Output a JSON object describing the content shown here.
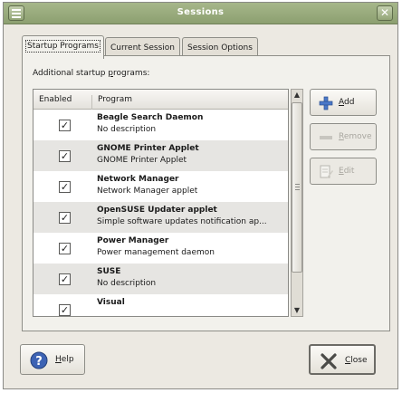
{
  "window": {
    "title": "Sessions"
  },
  "tabs": [
    {
      "label": "Startup Programs",
      "active": true
    },
    {
      "label": "Current Session",
      "active": false
    },
    {
      "label": "Session Options",
      "active": false
    }
  ],
  "startup": {
    "heading": "Additional startup programs:",
    "columns": {
      "enabled": "Enabled",
      "program": "Program"
    },
    "rows": [
      {
        "name": "Beagle Search Daemon",
        "description": "No description",
        "enabled": true
      },
      {
        "name": "GNOME Printer Applet",
        "description": "GNOME Printer Applet",
        "enabled": true
      },
      {
        "name": "Network Manager",
        "description": "Network Manager applet",
        "enabled": true
      },
      {
        "name": "OpenSUSE Updater applet",
        "description": "Simple software updates notification ap...",
        "enabled": true
      },
      {
        "name": "Power Manager",
        "description": "Power management daemon",
        "enabled": true
      },
      {
        "name": "SUSE",
        "description": "No description",
        "enabled": true
      },
      {
        "name": "Visual",
        "description": "",
        "enabled": true
      }
    ]
  },
  "buttons": {
    "add": {
      "pre": "",
      "accel": "A",
      "post": "dd",
      "enabled": true,
      "icon": "plus-icon"
    },
    "remove": {
      "pre": "",
      "accel": "R",
      "post": "emove",
      "enabled": false,
      "icon": "minus-icon"
    },
    "edit": {
      "pre": "",
      "accel": "E",
      "post": "dit",
      "enabled": false,
      "icon": "edit-icon"
    },
    "help": {
      "pre": "",
      "accel": "H",
      "post": "elp",
      "icon": "help-icon"
    },
    "close": {
      "pre": "",
      "accel": "C",
      "post": "lose",
      "icon": "close-icon"
    }
  },
  "colors": {
    "titlebar": "#9aac7e",
    "window_bg": "#ece9e2",
    "alt_row": "#e6e5e2",
    "help_icon": "#3d63b4"
  }
}
